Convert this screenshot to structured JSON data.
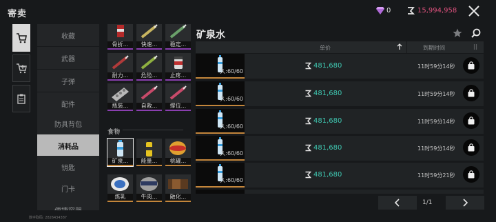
{
  "header": {
    "title": "寄卖",
    "gem_count": "0",
    "money": "15,994,958"
  },
  "categories": [
    {
      "label": "收藏",
      "active": false
    },
    {
      "label": "武器",
      "active": false
    },
    {
      "label": "子弹",
      "active": false
    },
    {
      "label": "配件",
      "active": false
    },
    {
      "label": "防具背包",
      "active": false
    },
    {
      "label": "消耗品",
      "active": true
    },
    {
      "label": "钥匙",
      "active": false
    },
    {
      "label": "门卡",
      "active": false
    },
    {
      "label": "便捷容器",
      "active": false
    }
  ],
  "item_grid": {
    "medical": [
      "骨折...",
      "快速...",
      "稳定...",
      "耐力...",
      "危险...",
      "止疼...",
      "瓶装...",
      "自救...",
      "撑位..."
    ],
    "food_section": "食物",
    "food": [
      "矿泉...",
      "能量...",
      "桃罐...",
      "炼乳",
      "牛肉...",
      "融化..."
    ]
  },
  "market": {
    "item_name": "矿泉水",
    "col_price": "单价",
    "col_expire": "到期时间",
    "listings": [
      {
        "durability": "久:60/60",
        "price": "481,680",
        "time_left": "11时59分14秒"
      },
      {
        "durability": "久:60/60",
        "price": "481,680",
        "time_left": "11时59分14秒"
      },
      {
        "durability": "久:60/60",
        "price": "481,680",
        "time_left": "11时59分14秒"
      },
      {
        "durability": "久:60/60",
        "price": "481,680",
        "time_left": "11时59分14秒"
      },
      {
        "durability": "久:60/60",
        "price": "481,680",
        "time_left": "11时59分21秒"
      }
    ],
    "page": "1/1"
  },
  "footer": {
    "uid": "数字取码: 2826434387"
  }
}
